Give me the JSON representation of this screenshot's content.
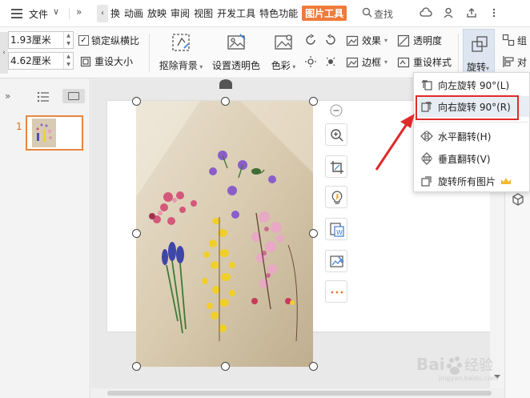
{
  "menubar": {
    "file_label": "文件",
    "tabs": [
      "换",
      "动画",
      "放映",
      "审阅",
      "视图",
      "开发工具",
      "特色功能",
      "图片工具"
    ],
    "search_label": "查找"
  },
  "ribbon": {
    "height_value": "1.93厘米",
    "width_value": "4.62厘米",
    "lock_ratio_label": "锁定纵横比",
    "reset_size_label": "重设大小",
    "remove_bg_label": "抠除背景",
    "set_transparent_label": "设置透明色",
    "color_label": "色彩",
    "effects_label": "效果",
    "transparency_label": "透明度",
    "border_label": "边框",
    "reset_style_label": "重设样式",
    "rotate_label": "旋转",
    "right_partial_1": "组",
    "right_partial_2": "对"
  },
  "slide_pane": {
    "slide_number": "1"
  },
  "rotate_menu": {
    "items": [
      {
        "label": "向左旋转 90°(L)"
      },
      {
        "label": "向右旋转 90°(R)"
      },
      {
        "label": "水平翻转(H)"
      },
      {
        "label": "垂直翻转(V)"
      },
      {
        "label": "旋转所有图片"
      }
    ]
  },
  "watermark": {
    "text": "Bai 经验",
    "sub": "jingyan.baidu.com"
  },
  "colors": {
    "accent_orange": "#f07a3a",
    "highlight_red": "#e02a2a",
    "selection_blue": "#dde6f0"
  }
}
